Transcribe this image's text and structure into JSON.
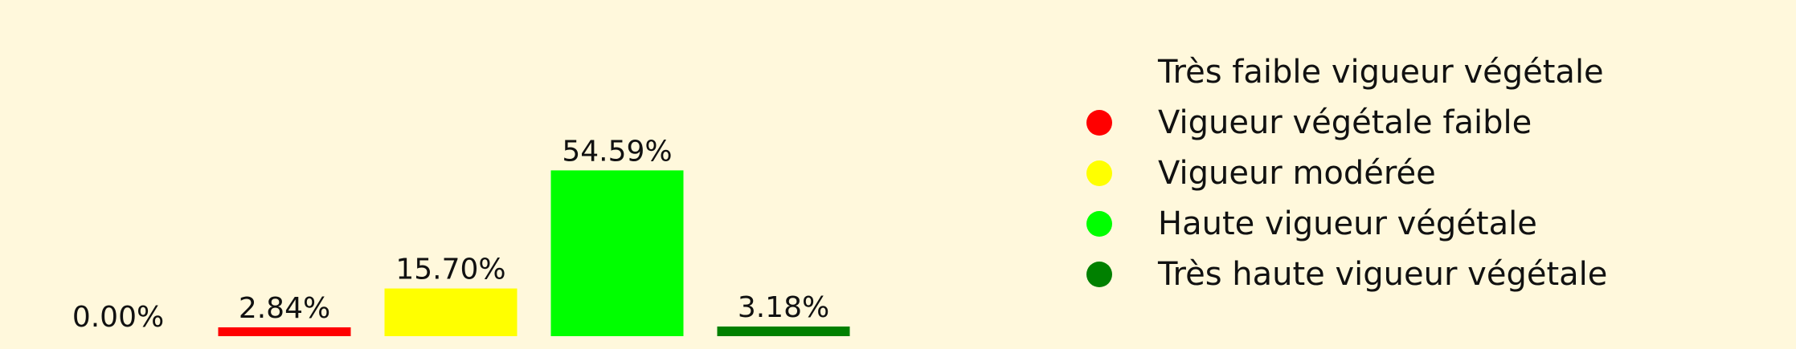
{
  "chart_data": {
    "type": "bar",
    "categories": [
      "Très faible vigueur végétale",
      "Vigueur végétale faible",
      "Vigueur modérée",
      "Haute vigueur végétale",
      "Très haute vigueur végétale"
    ],
    "values": [
      0.0,
      2.84,
      15.7,
      54.59,
      3.18
    ],
    "value_labels": [
      "0.00%",
      "2.84%",
      "15.70%",
      "54.59%",
      "3.18%"
    ],
    "colors": [
      "#fff8dc",
      "#ff0000",
      "#ffff00",
      "#00ff00",
      "#008000"
    ],
    "ylim": [
      0,
      60
    ],
    "grid": false,
    "legend_position": "right",
    "background_color": "#fff8dc",
    "title": "",
    "xlabel": "",
    "ylabel": ""
  },
  "legend": {
    "items": [
      {
        "label": "Très faible vigueur végétale",
        "color": "#fff8dc"
      },
      {
        "label": "Vigueur végétale faible",
        "color": "#ff0000"
      },
      {
        "label": "Vigueur modérée",
        "color": "#ffff00"
      },
      {
        "label": "Haute vigueur végétale",
        "color": "#00ff00"
      },
      {
        "label": "Très haute vigueur végétale",
        "color": "#008000"
      }
    ]
  }
}
